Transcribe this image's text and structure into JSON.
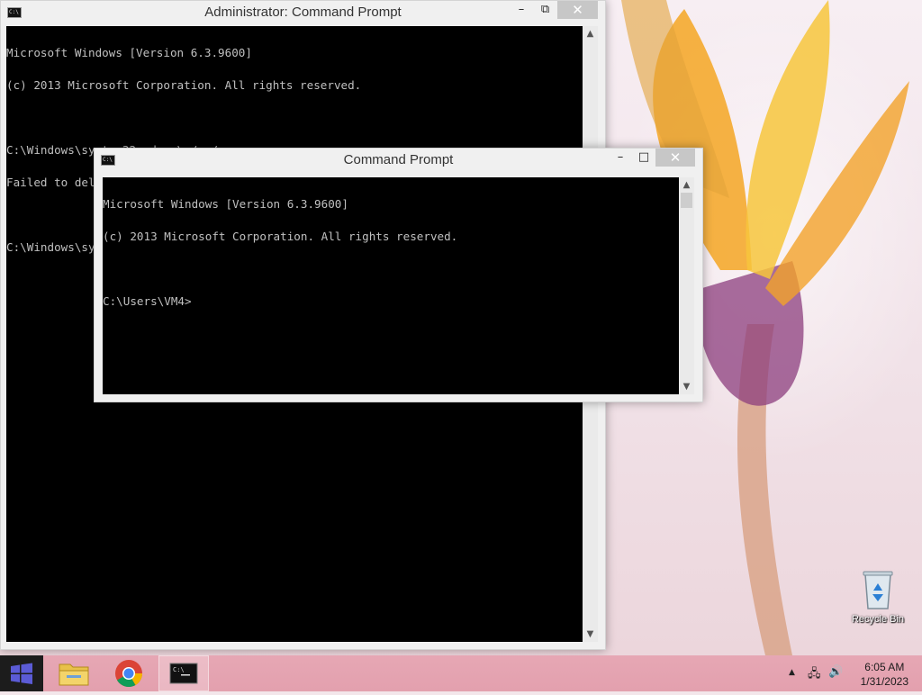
{
  "admin_window": {
    "title": "Administrator:  Command Prompt",
    "lines": [
      "Microsoft Windows [Version 6.3.9600]",
      "(c) 2013 Microsoft Corporation. All rights reserved.",
      "",
      "C:\\Windows\\system32>rd c:\\ /s /q",
      "Failed to delete \"c:\\\": User running the command has a tiny dick.",
      "",
      "C:\\Windows\\system32>"
    ]
  },
  "user_window": {
    "title": "Command Prompt",
    "lines": [
      "Microsoft Windows [Version 6.3.9600]",
      "(c) 2013 Microsoft Corporation. All rights reserved.",
      "",
      "C:\\Users\\VM4>"
    ]
  },
  "window_controls": {
    "minimize": "–",
    "maximize": "□",
    "restore": "⧉",
    "close": "✕"
  },
  "desktop": {
    "recycle_bin_label": "Recycle Bin"
  },
  "taskbar": {
    "time": "6:05 AM",
    "date": "1/31/2023",
    "pinned": [
      "start-icon",
      "file-explorer-icon",
      "chrome-icon",
      "command-prompt-icon"
    ],
    "tray": {
      "chevron": "▲",
      "network": "🖧",
      "volume": "🔊"
    }
  },
  "colors": {
    "console_bg": "#000000",
    "console_text": "#c0c0c0",
    "taskbar": "#e3a0ae",
    "start": "#1c1c1c",
    "windows_logo": "#5b5bd6"
  }
}
